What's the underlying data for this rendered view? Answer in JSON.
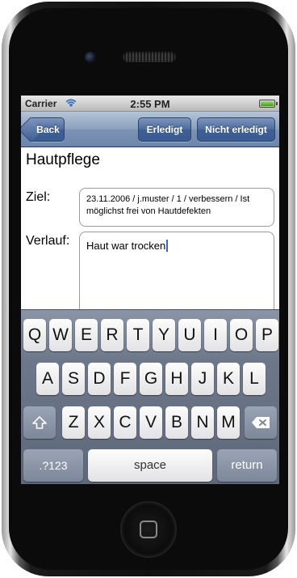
{
  "status_bar": {
    "carrier": "Carrier",
    "time": "2:55 PM",
    "wifi_icon": "wifi-icon",
    "battery_icon": "battery-icon"
  },
  "nav": {
    "back_label": "Back",
    "done_label": "Erledigt",
    "not_done_label": "Nicht erledigt"
  },
  "content": {
    "title": "Hautpflege",
    "ziel_label": "Ziel:",
    "ziel_value": "23.11.2006 / j.muster / 1 / verbessern / Ist möglichst frei von Hautdefekten",
    "verlauf_label": "Verlauf:",
    "verlauf_value": "Haut war trocken"
  },
  "keyboard": {
    "row1": [
      "Q",
      "W",
      "E",
      "R",
      "T",
      "Y",
      "U",
      "I",
      "O",
      "P"
    ],
    "row2": [
      "A",
      "S",
      "D",
      "F",
      "G",
      "H",
      "J",
      "K",
      "L"
    ],
    "row3": [
      "Z",
      "X",
      "C",
      "V",
      "B",
      "N",
      "M"
    ],
    "numbers_label": ".?123",
    "space_label": "space",
    "return_label": "return",
    "shift_icon": "shift-icon",
    "delete_icon": "delete-icon"
  },
  "colors": {
    "nav_bar": "#7d93b4",
    "nav_button": "#3d5f95",
    "cursor": "#3a63d8",
    "keyboard_bg": "#6c7789"
  }
}
